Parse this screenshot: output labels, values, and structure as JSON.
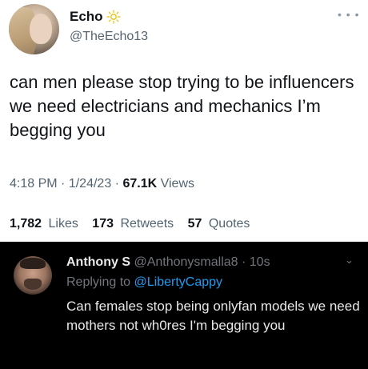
{
  "tweet": {
    "display_name": "Echo",
    "handle": "@TheEcho13",
    "text": "can men please stop trying to be influencers we need electricians and mechanics I’m begging you",
    "time": "4:18 PM",
    "date": "1/24/23",
    "views_count": "67.1K",
    "views_label": "Views",
    "likes_count": "1,782",
    "likes_label": "Likes",
    "retweets_count": "173",
    "retweets_label": "Retweets",
    "quotes_count": "57",
    "quotes_label": "Quotes",
    "more_icon": "more-icon",
    "name_badge_icon": "sun-icon"
  },
  "reply": {
    "display_name": "Anthony S",
    "handle": "@Anthonysmalla8",
    "age": "10s",
    "replying_prefix": "Replying to",
    "replying_to": "@LibertyCappy",
    "text": "Can females stop being onlyfan models we need mothers not wh0res I'm begging you"
  },
  "colors": {
    "link": "#1d9bf0",
    "muted_light": "#536471",
    "muted_dark": "#71767b",
    "reply_background": "#000000"
  }
}
